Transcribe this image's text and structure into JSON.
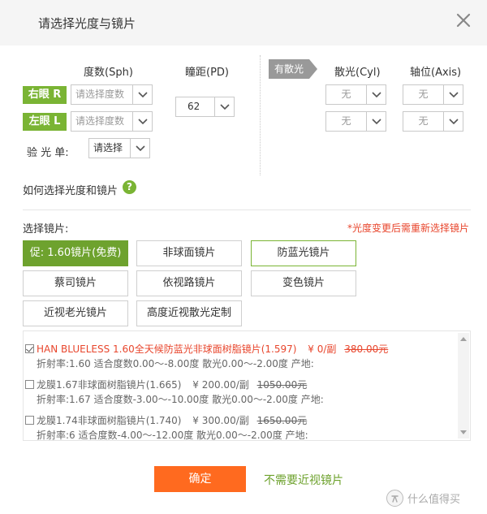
{
  "dialog": {
    "title": "请选择光度与镜片",
    "close_icon": "close-icon"
  },
  "prescription": {
    "sph_header": "度数(Sph)",
    "pd_header": "瞳距(PD)",
    "right_eye_label": "右眼 R",
    "left_eye_label": "左眼 L",
    "right_sph_placeholder": "请选择度数",
    "left_sph_placeholder": "请选择度数",
    "pd_value": "62",
    "sheet_label": "验 光 单:",
    "sheet_value": "请选择",
    "astig_tag": "有散光",
    "cyl_header": "散光(Cyl)",
    "axis_header": "轴位(Axis)",
    "right_cyl": "无",
    "right_axis": "无",
    "left_cyl": "无",
    "left_axis": "无"
  },
  "help": {
    "link_text": "如何选择光度和镜片",
    "icon_text": "?"
  },
  "lens": {
    "section_label": "选择镜片:",
    "warning": "*光度变更后需重新选择镜片",
    "options": [
      {
        "label": "促: 1.60镜片(免费)"
      },
      {
        "label": "非球面镜片"
      },
      {
        "label": "防蓝光镜片"
      },
      {
        "label": "蔡司镜片"
      },
      {
        "label": "依视路镜片"
      },
      {
        "label": "变色镜片"
      },
      {
        "label": "近视老光镜片"
      },
      {
        "label": "高度近视散光定制"
      }
    ]
  },
  "products": [
    {
      "name": "HAN BLUELESS 1.60全天候防蓝光非球面树脂镜片(1.597)",
      "price": "¥ 0/副",
      "original_price": "380.00元",
      "specs": "折射率:1.60 适合度数0.00～-8.00度 散光0.00～-2.00度 产地:",
      "checked": true
    },
    {
      "name": "龙膜1.67非球面树脂镜片(1.665)",
      "price": "¥ 200.00/副",
      "original_price": "1050.00元",
      "specs": "折射率:1.67 适合度数-3.00～-10.00度 散光0.00～-2.00度 产地:",
      "checked": false
    },
    {
      "name": "龙膜1.74非球面树脂镜片(1.740)",
      "price": "¥ 300.00/副",
      "original_price": "1650.00元",
      "specs": "折射率:6 适合度数-4.00～-12.00度 散光0.00～-2.00度 产地:",
      "checked": false
    }
  ],
  "footer": {
    "confirm_label": "确定",
    "no_lens_label": "不需要近视镜片"
  },
  "watermark": {
    "text": "什么值得买"
  },
  "colors": {
    "accent_green": "#7ab434",
    "selected_green": "#6ea22e",
    "confirm_orange": "#ff6a1f",
    "warning_red": "#e8462d",
    "header_bg": "#f5f5f5"
  }
}
